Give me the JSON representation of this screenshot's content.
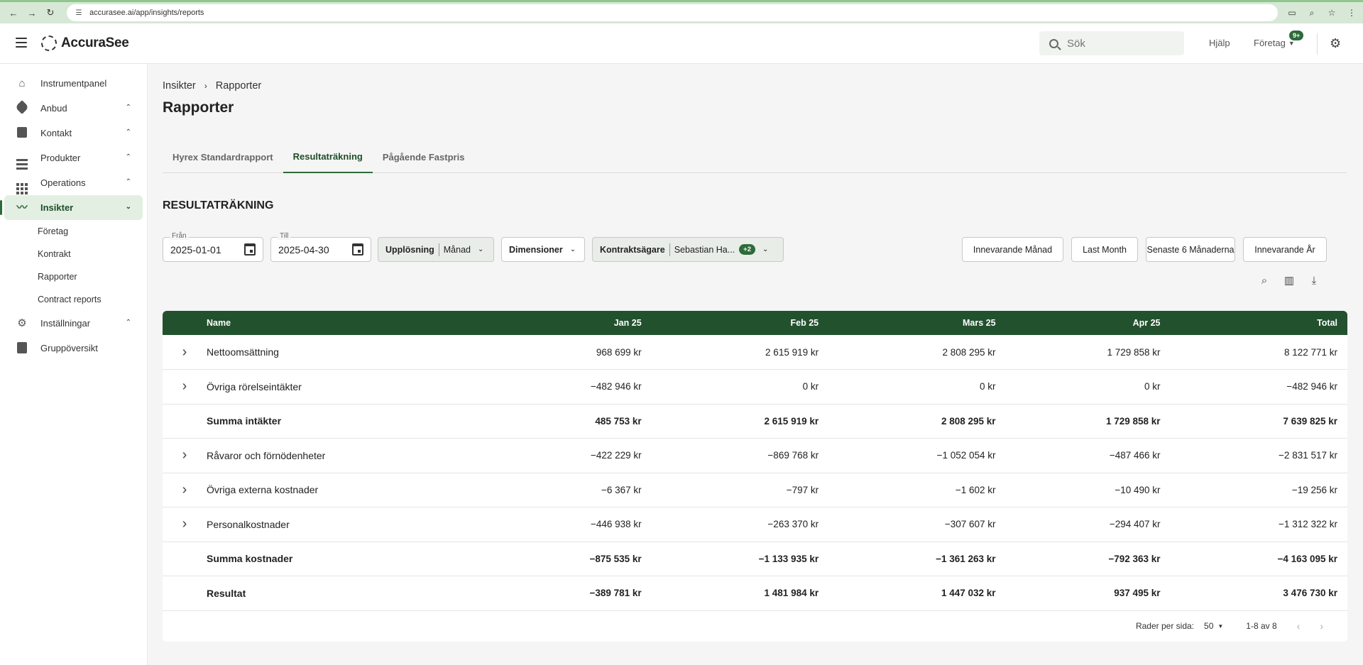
{
  "browser": {
    "url": "accurasee.ai/app/insights/reports"
  },
  "header": {
    "brand": "AccuraSee",
    "search_placeholder": "Sök",
    "help": "Hjälp",
    "company": "Företag",
    "badge": "9+"
  },
  "sidebar": {
    "items": [
      {
        "label": "Instrumentpanel",
        "icon": "home-icon"
      },
      {
        "label": "Anbud",
        "icon": "tag-icon"
      },
      {
        "label": "Kontakt",
        "icon": "document-icon"
      },
      {
        "label": "Produkter",
        "icon": "list-icon"
      },
      {
        "label": "Operations",
        "icon": "grid-icon"
      },
      {
        "label": "Insikter",
        "icon": "trending-icon"
      },
      {
        "label": "Inställningar",
        "icon": "gear-icon"
      },
      {
        "label": "Gruppöversikt",
        "icon": "clipboard-icon"
      }
    ],
    "sub_items": [
      "Företag",
      "Kontrakt",
      "Rapporter",
      "Contract reports"
    ]
  },
  "breadcrumb": {
    "parent": "Insikter",
    "current": "Rapporter"
  },
  "page_title": "Rapporter",
  "tabs": [
    "Hyrex Standardrapport",
    "Resultaträkning",
    "Pågående Fastpris"
  ],
  "section_title": "RESULTATRÄKNING",
  "filters": {
    "from_label": "Från",
    "from_value": "2025-01-01",
    "to_label": "Till",
    "to_value": "2025-04-30",
    "resolution_label": "Upplösning",
    "resolution_value": "Månad",
    "dimensions_label": "Dimensioner",
    "owner_label": "Kontraktsägare",
    "owner_value": "Sebastian Ha...",
    "owner_chip": "+2",
    "presets": [
      "Innevarande Månad",
      "Last Month",
      "Senaste 6 Månaderna",
      "Innevarande År"
    ]
  },
  "table": {
    "columns": [
      "Name",
      "Jan 25",
      "Feb 25",
      "Mars 25",
      "Apr 25",
      "Total"
    ],
    "rows": [
      {
        "expandable": true,
        "bold": false,
        "cells": [
          "Nettoomsättning",
          "968 699 kr",
          "2 615 919 kr",
          "2 808 295 kr",
          "1 729 858 kr",
          "8 122 771 kr"
        ]
      },
      {
        "expandable": true,
        "bold": false,
        "cells": [
          "Övriga rörelseintäkter",
          "−482 946 kr",
          "0 kr",
          "0 kr",
          "0 kr",
          "−482 946 kr"
        ]
      },
      {
        "expandable": false,
        "bold": true,
        "cells": [
          "Summa intäkter",
          "485 753 kr",
          "2 615 919 kr",
          "2 808 295 kr",
          "1 729 858 kr",
          "7 639 825 kr"
        ]
      },
      {
        "expandable": true,
        "bold": false,
        "cells": [
          "Råvaror och förnödenheter",
          "−422 229 kr",
          "−869 768 kr",
          "−1 052 054 kr",
          "−487 466 kr",
          "−2 831 517 kr"
        ]
      },
      {
        "expandable": true,
        "bold": false,
        "cells": [
          "Övriga externa kostnader",
          "−6 367 kr",
          "−797 kr",
          "−1 602 kr",
          "−10 490 kr",
          "−19 256 kr"
        ]
      },
      {
        "expandable": true,
        "bold": false,
        "cells": [
          "Personalkostnader",
          "−446 938 kr",
          "−263 370 kr",
          "−307 607 kr",
          "−294 407 kr",
          "−1 312 322 kr"
        ]
      },
      {
        "expandable": false,
        "bold": true,
        "cells": [
          "Summa kostnader",
          "−875 535 kr",
          "−1 133 935 kr",
          "−1 361 263 kr",
          "−792 363 kr",
          "−4 163 095 kr"
        ]
      },
      {
        "expandable": false,
        "bold": true,
        "cells": [
          "Resultat",
          "−389 781 kr",
          "1 481 984 kr",
          "1 447 032 kr",
          "937 495 kr",
          "3 476 730 kr"
        ]
      }
    ]
  },
  "pager": {
    "rows_per_page_label": "Rader per sida:",
    "rows_per_page": "50",
    "range": "1-8 av 8"
  },
  "colors": {
    "accent": "#22512e",
    "active_bg": "#e3efe2"
  }
}
